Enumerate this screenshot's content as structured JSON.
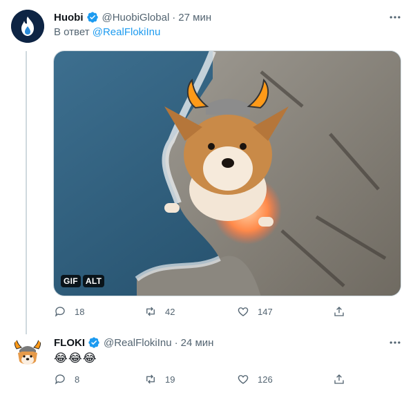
{
  "tweet1": {
    "author_name": "Huobi",
    "handle": "@HuobiGlobal",
    "separator": "·",
    "time": "27 мин",
    "reply_prefix": "В ответ",
    "reply_to": "@RealFlokiInu",
    "media_badges": {
      "gif": "GIF",
      "alt": "ALT"
    },
    "stats": {
      "replies": "18",
      "retweets": "42",
      "likes": "147"
    },
    "avatar_icon": "huobi-flame-icon"
  },
  "tweet2": {
    "author_name": "FLOKI",
    "handle": "@RealFlokiInu",
    "separator": "·",
    "time": "24 мин",
    "text": "😂😂😂",
    "stats": {
      "replies": "8",
      "retweets": "19",
      "likes": "126"
    },
    "avatar_icon": "floki-viking-dog-icon"
  },
  "colors": {
    "verified": "#1d9bf0",
    "link": "#1d9bf0",
    "muted": "#536471",
    "text": "#0f1419",
    "thread_line": "#cfd9de"
  }
}
